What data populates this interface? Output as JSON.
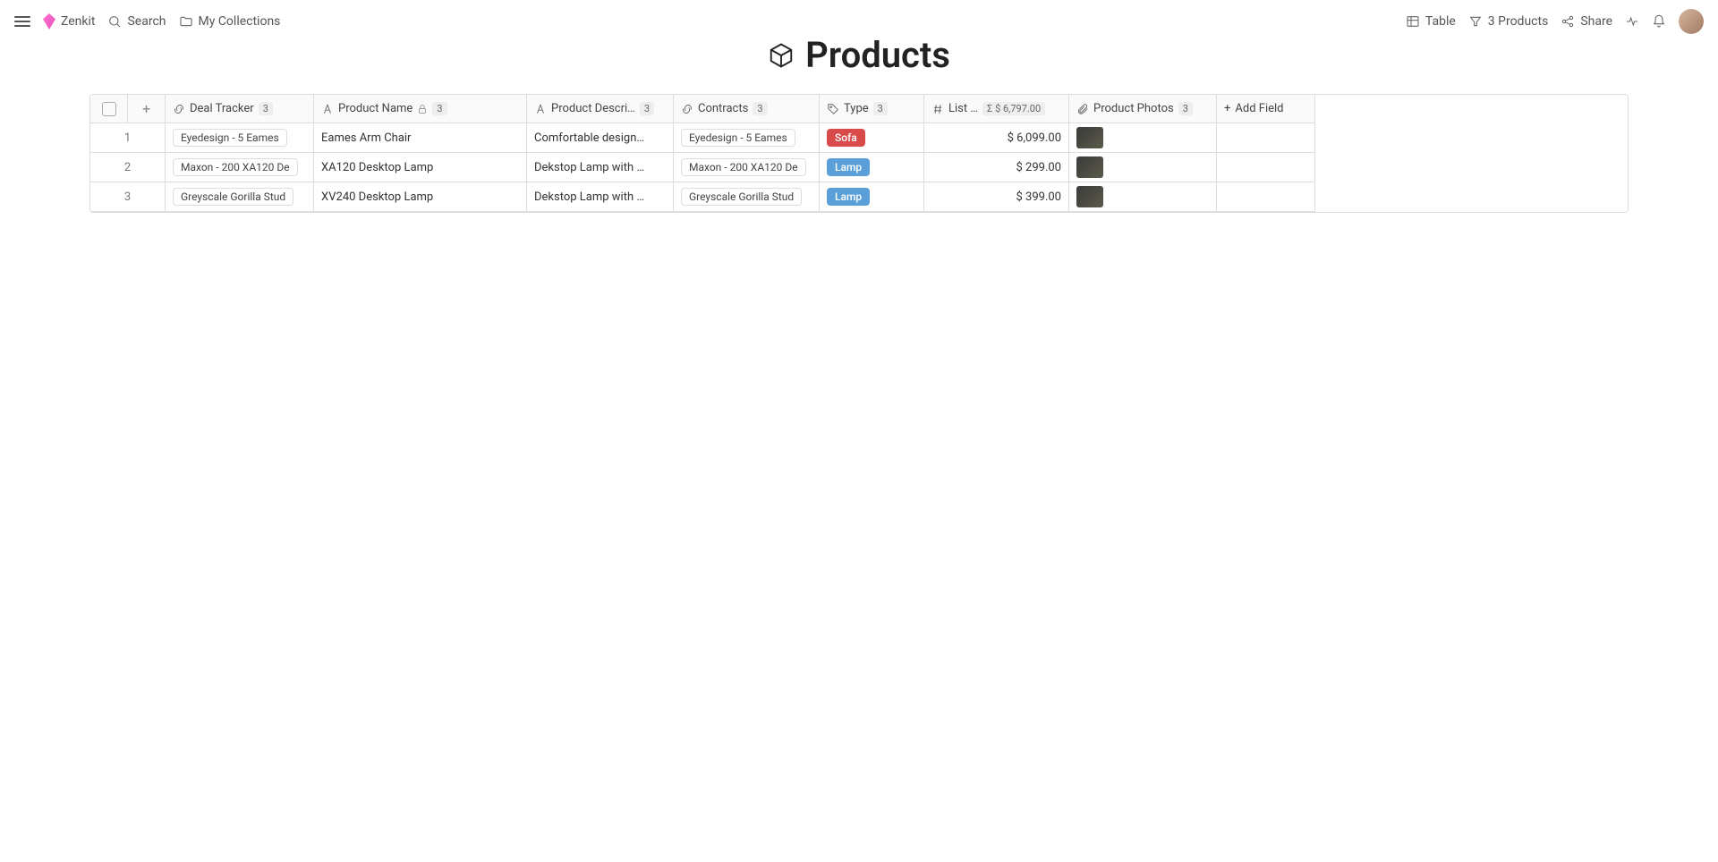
{
  "topbar": {
    "app_name": "Zenkit",
    "search": "Search",
    "my_collections": "My Collections",
    "view_label": "Table",
    "filter_label": "3 Products",
    "share": "Share"
  },
  "page": {
    "title": "Products"
  },
  "columns": {
    "deal_tracker": {
      "label": "Deal Tracker",
      "count": "3"
    },
    "product_name": {
      "label": "Product Name",
      "count": "3"
    },
    "product_description": {
      "label": "Product Descri…",
      "count": "3"
    },
    "contracts": {
      "label": "Contracts",
      "count": "3"
    },
    "type": {
      "label": "Type",
      "count": "3"
    },
    "list_price": {
      "label": "List …",
      "sum": "$ 6,797.00"
    },
    "product_photos": {
      "label": "Product Photos",
      "count": "3"
    },
    "add_field": {
      "label": "Add Field"
    }
  },
  "rows": [
    {
      "num": "1",
      "deal_tracker": "Eyedesign - 5 Eames",
      "product_name": "Eames Arm Chair",
      "product_description": "Comfortable design…",
      "contract": "Eyedesign - 5 Eames",
      "type": "Sofa",
      "type_class": "sofa",
      "price": "$ 6,099.00"
    },
    {
      "num": "2",
      "deal_tracker": "Maxon - 200 XA120 De",
      "product_name": "XA120 Desktop Lamp",
      "product_description": "Dekstop Lamp with …",
      "contract": "Maxon - 200 XA120 De",
      "type": "Lamp",
      "type_class": "lamp",
      "price": "$ 299.00"
    },
    {
      "num": "3",
      "deal_tracker": "Greyscale Gorilla Stud",
      "product_name": "XV240 Desktop Lamp",
      "product_description": "Dekstop Lamp with …",
      "contract": "Greyscale Gorilla Stud",
      "type": "Lamp",
      "type_class": "lamp",
      "price": "$ 399.00"
    }
  ]
}
